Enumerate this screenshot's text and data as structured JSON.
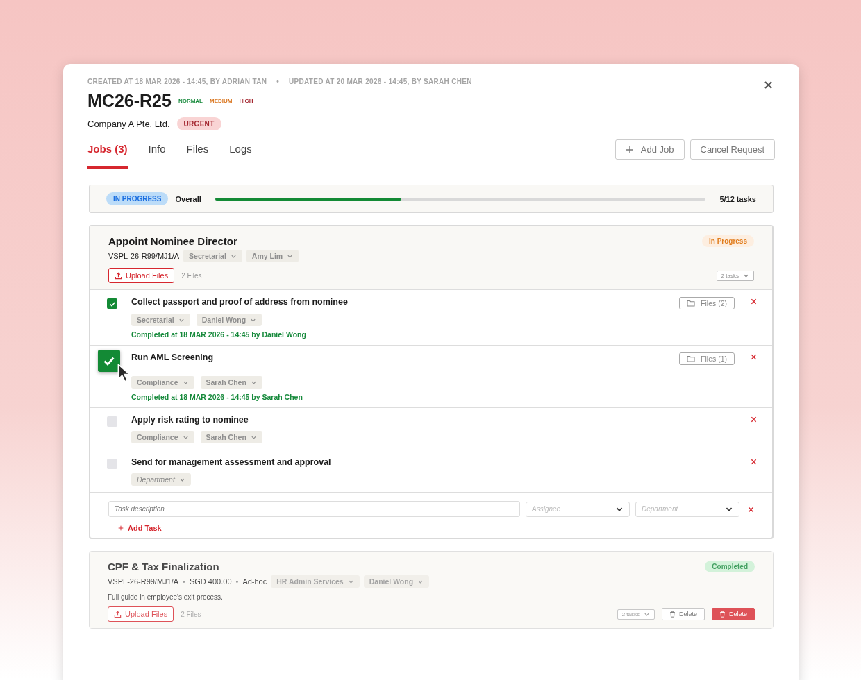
{
  "header": {
    "created": "CREATED AT 18 MAR 2026 - 14:45, BY ADRIAN TAN",
    "separator": "•",
    "updated": "UPDATED AT 20 MAR 2026 - 14:45, BY SARAH CHEN",
    "title": "MC26-R25",
    "priorities": [
      {
        "label": "NORMAL",
        "color": "#178a3c"
      },
      {
        "label": "MEDIUM",
        "color": "#d9731a"
      },
      {
        "label": "HIGH",
        "color": "#a3262f"
      }
    ],
    "company": "Company A Pte. Ltd.",
    "urgency": "URGENT"
  },
  "tabs": [
    {
      "label": "Jobs (3)",
      "selected": true
    },
    {
      "label": "Info",
      "selected": false
    },
    {
      "label": "Files",
      "selected": false
    },
    {
      "label": "Logs",
      "selected": false
    }
  ],
  "actions": [
    {
      "label": "Add Job",
      "kind": "add"
    },
    {
      "label": "Cancel Request",
      "kind": "plain"
    }
  ],
  "overall": {
    "status": "IN PROGRESS",
    "label": "Overall",
    "level": 0.38,
    "count": "5/12 tasks"
  },
  "jobs": [
    {
      "title": "Appoint Nominee Director",
      "status": "In Progress",
      "kind": "in_progress",
      "meta": [
        "VSPL-26-R99/MJ1/A"
      ],
      "tags": [
        "Secretarial",
        "Amy Lim"
      ],
      "upload": "Upload Files",
      "files": "2 Files",
      "tasks_toggle": "2 tasks",
      "faded": false,
      "tasks": [
        {
          "title": "Collect passport and proof of address from nominee",
          "checked": true,
          "hovered": false,
          "tags": [
            {
              "label": "Secretarial",
              "placeholder": false
            },
            {
              "label": "Daniel Wong",
              "placeholder": false
            }
          ],
          "completed": "Completed at 18 MAR 2026 - 14:45 by Daniel Wong",
          "files": "Files (2)"
        },
        {
          "title": "Run AML Screening",
          "checked": true,
          "hovered": true,
          "tags": [
            {
              "label": "Compliance",
              "placeholder": false
            },
            {
              "label": "Sarah Chen",
              "placeholder": false
            }
          ],
          "completed": "Completed at 18 MAR 2026 - 14:45 by Sarah Chen",
          "files": "Files (1)"
        },
        {
          "title": "Apply risk rating to nominee",
          "checked": false,
          "hovered": false,
          "tags": [
            {
              "label": "Compliance",
              "placeholder": false
            },
            {
              "label": "Sarah Chen",
              "placeholder": false
            }
          ]
        },
        {
          "title": "Send for management assessment and approval",
          "checked": false,
          "hovered": false,
          "tags": [
            {
              "label": "Department",
              "placeholder": true
            }
          ]
        }
      ],
      "new_task": {
        "description_placeholder": "Task description",
        "assignee_placeholder": "Assignee",
        "department_placeholder": "Department"
      },
      "add_task": "Add Task"
    },
    {
      "title": "CPF & Tax Finalization",
      "status": "Completed",
      "kind": "completed",
      "meta_separator": "•",
      "meta": [
        "VSPL-26-R99/MJ1/A",
        "SGD 400.00",
        "Ad-hoc"
      ],
      "tags": [
        "HR Admin Services",
        "Daniel Wong"
      ],
      "description": "Full guide in employee's exit process.",
      "upload": "Upload Files",
      "files": "2 Files",
      "tasks_toggle": "2 tasks",
      "faded": true,
      "delete_buttons": [
        {
          "label": "Delete",
          "kind": "outline"
        },
        {
          "label": "Delete",
          "kind": "danger"
        }
      ]
    }
  ]
}
